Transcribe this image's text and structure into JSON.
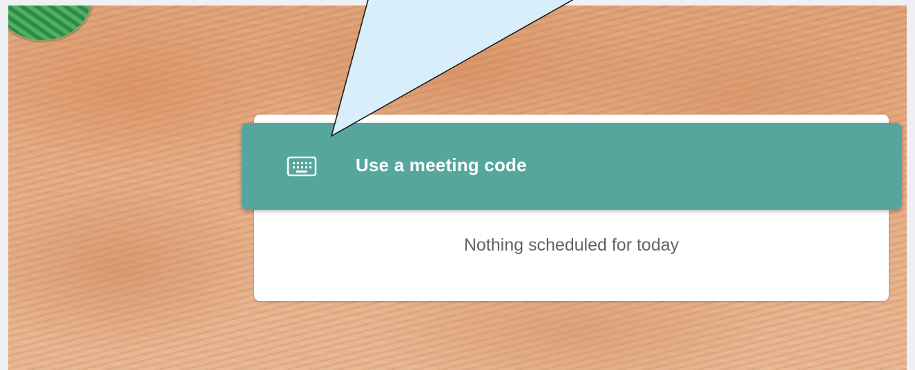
{
  "background": {
    "icon": "painted-wood-background"
  },
  "meeting_code": {
    "label": "Use a meeting code",
    "icon": "keyboard-icon",
    "color": "#56a69e"
  },
  "schedule": {
    "empty_message": "Nothing scheduled for today"
  },
  "callout": {
    "fill": "#d8eefa",
    "stroke": "#1b1b1b"
  }
}
